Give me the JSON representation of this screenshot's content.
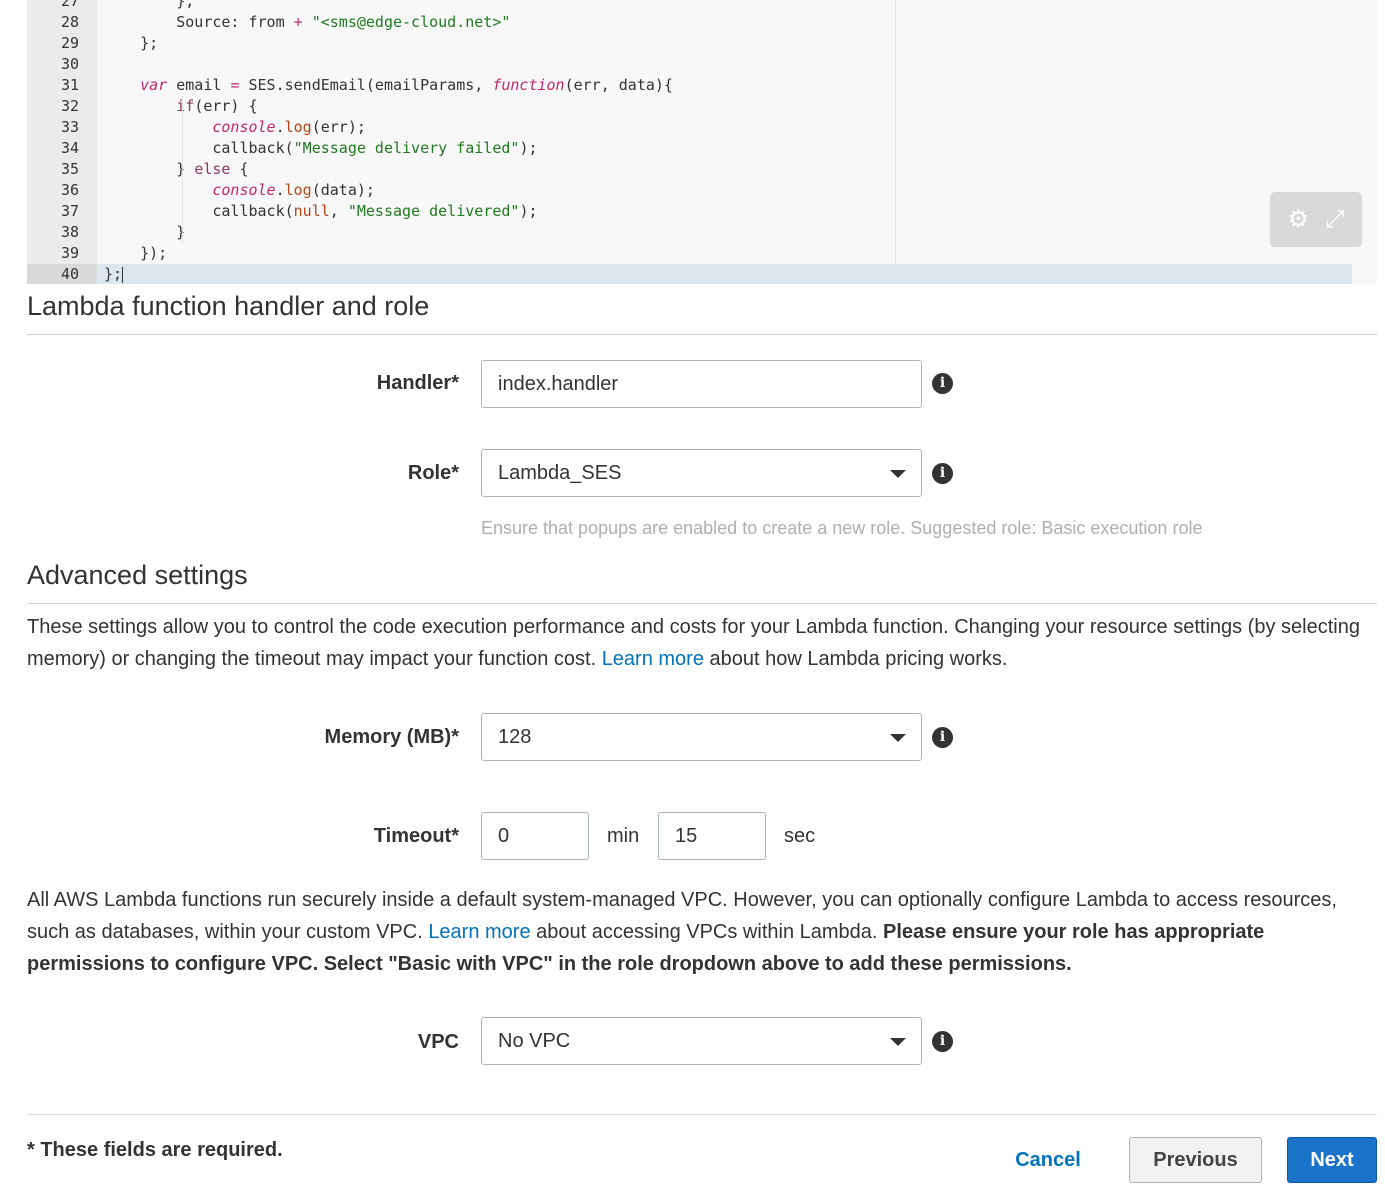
{
  "editor": {
    "lines": [
      {
        "n": "27",
        "indent": "        ",
        "parts": [
          {
            "t": "},",
            "c": ""
          }
        ]
      },
      {
        "n": "28",
        "indent": "        ",
        "parts": [
          {
            "t": "Source: from ",
            "c": ""
          },
          {
            "t": "+",
            "c": "tok-op"
          },
          {
            "t": " ",
            "c": ""
          },
          {
            "t": "\"<sms@edge-cloud.net>\"",
            "c": "tok-str"
          }
        ]
      },
      {
        "n": "29",
        "indent": "    ",
        "parts": [
          {
            "t": "};",
            "c": ""
          }
        ]
      },
      {
        "n": "30",
        "indent": "",
        "parts": []
      },
      {
        "n": "31",
        "indent": "    ",
        "parts": [
          {
            "t": "var",
            "c": "tok-kw"
          },
          {
            "t": " email ",
            "c": ""
          },
          {
            "t": "=",
            "c": "tok-op"
          },
          {
            "t": " SES.sendEmail(emailParams, ",
            "c": ""
          },
          {
            "t": "function",
            "c": "tok-fn"
          },
          {
            "t": "(err, data){",
            "c": ""
          }
        ]
      },
      {
        "n": "32",
        "indent": "        ",
        "parts": [
          {
            "t": "if",
            "c": "tok-kw2"
          },
          {
            "t": "(err) {",
            "c": ""
          }
        ]
      },
      {
        "n": "33",
        "indent": "            ",
        "parts": [
          {
            "t": "console",
            "c": "tok-fn"
          },
          {
            "t": ".",
            "c": ""
          },
          {
            "t": "log",
            "c": "tok-call"
          },
          {
            "t": "(err);",
            "c": ""
          }
        ]
      },
      {
        "n": "34",
        "indent": "            ",
        "parts": [
          {
            "t": "callback(",
            "c": ""
          },
          {
            "t": "\"Message delivery failed\"",
            "c": "tok-str"
          },
          {
            "t": ");",
            "c": ""
          }
        ]
      },
      {
        "n": "35",
        "indent": "        ",
        "parts": [
          {
            "t": "} ",
            "c": ""
          },
          {
            "t": "else",
            "c": "tok-kw2"
          },
          {
            "t": " {",
            "c": ""
          }
        ]
      },
      {
        "n": "36",
        "indent": "            ",
        "parts": [
          {
            "t": "console",
            "c": "tok-fn"
          },
          {
            "t": ".",
            "c": ""
          },
          {
            "t": "log",
            "c": "tok-call"
          },
          {
            "t": "(data);",
            "c": ""
          }
        ]
      },
      {
        "n": "37",
        "indent": "            ",
        "parts": [
          {
            "t": "callback(",
            "c": ""
          },
          {
            "t": "null",
            "c": "tok-null"
          },
          {
            "t": ", ",
            "c": ""
          },
          {
            "t": "\"Message delivered\"",
            "c": "tok-str"
          },
          {
            "t": ");",
            "c": ""
          }
        ]
      },
      {
        "n": "38",
        "indent": "        ",
        "parts": [
          {
            "t": "}",
            "c": ""
          }
        ]
      },
      {
        "n": "39",
        "indent": "    ",
        "parts": [
          {
            "t": "});",
            "c": ""
          }
        ]
      },
      {
        "n": "40",
        "indent": "",
        "parts": [
          {
            "t": "};",
            "c": ""
          }
        ],
        "active": true
      }
    ],
    "tools": {
      "settings_icon": "gear-icon",
      "fullscreen_icon": "expand-icon"
    }
  },
  "handler_section": {
    "title": "Lambda function handler and role",
    "handler_label": "Handler*",
    "handler_value": "index.handler",
    "role_label": "Role*",
    "role_value": "Lambda_SES",
    "role_hint": "Ensure that popups are enabled to create a new role. Suggested role: Basic execution role"
  },
  "advanced": {
    "title": "Advanced settings",
    "intro_before": "These settings allow you to control the code execution performance and costs for your Lambda function. Changing your resource settings (by selecting memory) or changing the timeout may impact your function cost. ",
    "intro_link": "Learn more",
    "intro_after": " about how Lambda pricing works.",
    "memory_label": "Memory (MB)*",
    "memory_value": "128",
    "timeout_label": "Timeout*",
    "timeout_min": "0",
    "timeout_min_unit": "min",
    "timeout_sec": "15",
    "timeout_sec_unit": "sec",
    "vpc_before": "All AWS Lambda functions run securely inside a default system-managed VPC. However, you can optionally configure Lambda to access resources, such as databases, within your custom VPC. ",
    "vpc_link": "Learn more",
    "vpc_mid": " about accessing VPCs within Lambda. ",
    "vpc_bold": "Please ensure your role has appropriate permissions to configure VPC. Select \"Basic with VPC\" in the role dropdown above to add these permissions.",
    "vpc_label": "VPC",
    "vpc_value": "No VPC"
  },
  "footer": {
    "required_note": "* These fields are required.",
    "cancel": "Cancel",
    "previous": "Previous",
    "next": "Next"
  }
}
